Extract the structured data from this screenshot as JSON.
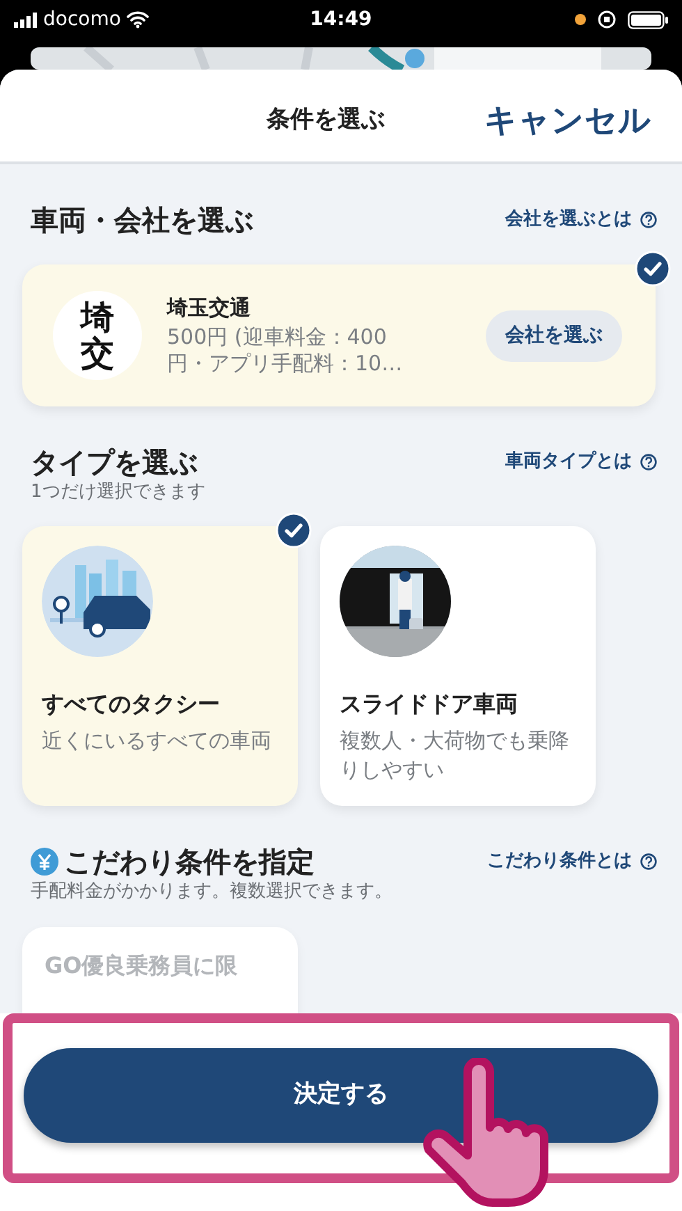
{
  "status_bar": {
    "carrier": "docomo",
    "time": "14:49"
  },
  "header": {
    "title": "条件を選ぶ",
    "cancel": "キャンセル"
  },
  "sections": [
    {
      "kind": "company",
      "title": "車両・会社を選ぶ",
      "help_link": "会社を選ぶとは",
      "company": {
        "logo": "埼交",
        "name": "埼玉交通",
        "description": "500円 (迎車料金：400円・アプリ手配料：10…",
        "button": "会社を選ぶ",
        "selected": true
      }
    },
    {
      "kind": "types",
      "title": "タイプを選ぶ",
      "subtitle": "1つだけ選択できます",
      "help_link": "車両タイプとは",
      "options": [
        {
          "title": "すべてのタクシー",
          "description": "近くにいるすべての車両",
          "selected": true
        },
        {
          "title": "スライドドア車両",
          "description": "複数人・大荷物でも乗降りしやすい",
          "selected": false
        }
      ]
    },
    {
      "kind": "extras",
      "paid": true,
      "title": "こだわり条件を指定",
      "subtitle": "手配料金がかかります。複数選択できます。",
      "help_link": "こだわり条件とは",
      "options": [
        {
          "title": "GO優良乗務員に限",
          "selected": false
        }
      ]
    }
  ],
  "confirm_button": "決定する"
}
